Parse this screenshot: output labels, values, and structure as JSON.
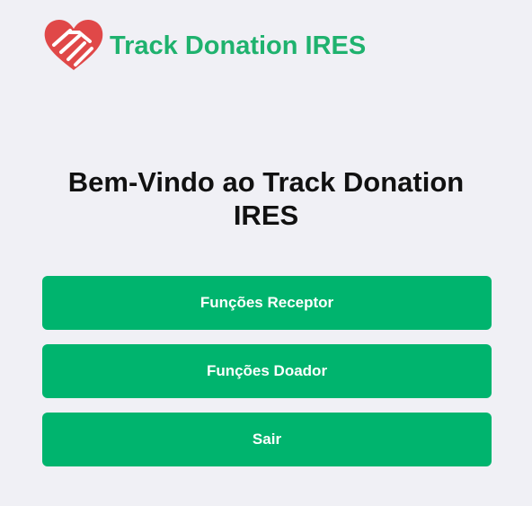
{
  "header": {
    "logo_icon": "heart-handshake-icon",
    "title": "Track Donation IRES"
  },
  "main": {
    "welcome": "Bem-Vindo ao Track Donation IRES",
    "buttons": [
      {
        "label": "Funções Receptor"
      },
      {
        "label": "Funções Doador"
      },
      {
        "label": "Sair"
      }
    ]
  },
  "colors": {
    "brand_green": "#1fb26e",
    "button_green": "#00b46e",
    "logo_red": "#e04848",
    "background": "#f0f0f5"
  }
}
